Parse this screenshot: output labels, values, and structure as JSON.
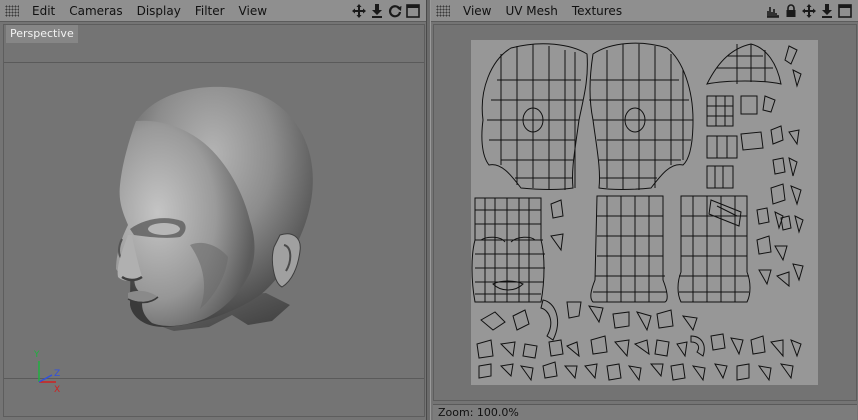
{
  "left_panel": {
    "menu": [
      "Edit",
      "Cameras",
      "Display",
      "Filter",
      "View"
    ],
    "tools": [
      "move-arrows-icon",
      "down-arrows-icon",
      "rotate-icon",
      "maximize-icon"
    ],
    "viewport": {
      "label": "Perspective",
      "axes": {
        "y": "Y",
        "z": "Z",
        "x": "X"
      }
    }
  },
  "right_panel": {
    "menu": [
      "View",
      "UV Mesh",
      "Textures"
    ],
    "tools": [
      "histogram-icon",
      "lock-icon",
      "move-arrows-icon",
      "down-arrows-icon",
      "maximize-icon"
    ],
    "status": "Zoom: 100.0%"
  },
  "colors": {
    "menubar": "#8f8f8f",
    "panel_bg": "#747474",
    "uv_canvas": "#979797",
    "uv_lines": "#111111",
    "axis_x": "#d02020",
    "axis_y": "#20b040",
    "axis_z": "#3050e0"
  }
}
